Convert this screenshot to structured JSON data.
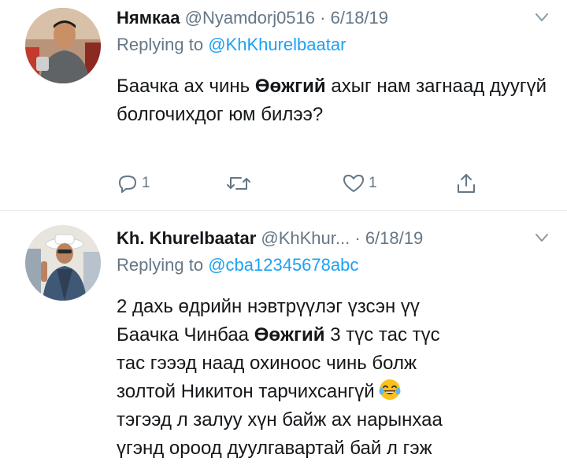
{
  "tweets": [
    {
      "name": "Нямкаа",
      "handle": "@Nyamdorj0516",
      "separator": "·",
      "date": "6/18/19",
      "replying_prefix": "Replying to",
      "replying_to": "@KhKhurelbaatar",
      "body_before": "Баачка ах чинь ",
      "body_bold": "Өөжгий",
      "body_after": " ахыг нам загнаад дуугүй болгочихдог юм билээ?",
      "actions": {
        "reply_count": "1",
        "retweet_count": "",
        "like_count": "1"
      },
      "icons": [
        "caret-down-icon",
        "reply-icon",
        "retweet-icon",
        "like-icon",
        "share-icon"
      ]
    },
    {
      "name": "Kh. Khurelbaatar",
      "handle": "@KhKhur...",
      "separator": "·",
      "date": "6/18/19",
      "replying_prefix": "Replying to",
      "replying_to": "@cba12345678abc",
      "line1": "2 дахь өдрийн нэвтрүүлэг үзсэн үү",
      "line2_before": "Баачка Чинбаа ",
      "line2_bold": "Өөжгий",
      "line2_after": " 3 түс тас түс",
      "line3": "тас гэээд наад охиноос чинь болж",
      "line4": "золтой Никитон тарчихсангүй",
      "line5": "тэгээд л залуу хүн байж ах нарынхаа",
      "line6": "үгэнд ороод дуулгавартай бай л гэж",
      "icons": [
        "caret-down-icon",
        "laughing-emoji-icon"
      ]
    }
  ],
  "colors": {
    "primary_text": "#14171a",
    "secondary_text": "#657786",
    "link": "#1da1f2",
    "divider": "#e6ecf0"
  }
}
